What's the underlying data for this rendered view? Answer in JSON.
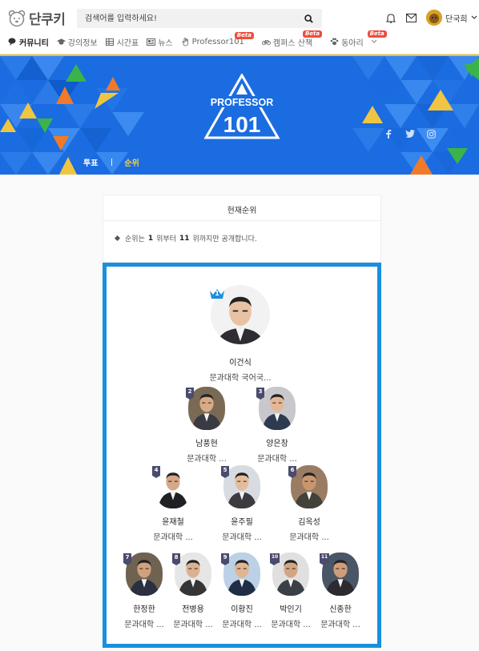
{
  "header": {
    "logo_text": "단쿠키",
    "search_placeholder": "검색어를 입력하세요!",
    "user_name": "단국희",
    "nav": [
      {
        "label": "커뮤니티",
        "icon": "chat-icon",
        "active": true
      },
      {
        "label": "강의정보",
        "icon": "graduation-cap-icon"
      },
      {
        "label": "시간표",
        "icon": "table-icon"
      },
      {
        "label": "뉴스",
        "icon": "newspaper-icon"
      },
      {
        "label": "Professor101",
        "icon": "hand-icon",
        "badge": "Beta"
      },
      {
        "label": "캠퍼스 산책",
        "icon": "bicycle-icon",
        "badge": "Beta"
      },
      {
        "label": "동아리",
        "icon": "paw-icon",
        "badge": "Beta"
      }
    ]
  },
  "banner": {
    "brand_top": "PROFESSOR",
    "brand_number": "101",
    "tabs": [
      {
        "label": "투표"
      },
      {
        "label": "순위",
        "active": true
      }
    ],
    "social": [
      "facebook-icon",
      "twitter-icon",
      "instagram-icon"
    ]
  },
  "panel": {
    "title": "현재순위",
    "note_prefix": "순위는",
    "note_from": "1",
    "note_mid": "위부터",
    "note_to": "11",
    "note_suffix": "위까지만 공개합니다."
  },
  "ranking": [
    {
      "rank": "1",
      "name": "이건식",
      "dept": "문과대학 국어국..."
    },
    {
      "rank": "2",
      "name": "남풍현",
      "dept": "문과대학 ..."
    },
    {
      "rank": "3",
      "name": "양은창",
      "dept": "문과대학 ..."
    },
    {
      "rank": "4",
      "name": "윤재철",
      "dept": "문과대학 ..."
    },
    {
      "rank": "5",
      "name": "윤주필",
      "dept": "문과대학 ..."
    },
    {
      "rank": "6",
      "name": "김옥성",
      "dept": "문과대학 ..."
    },
    {
      "rank": "7",
      "name": "한정한",
      "dept": "문과대학 ..."
    },
    {
      "rank": "8",
      "name": "전병용",
      "dept": "문과대학 ..."
    },
    {
      "rank": "9",
      "name": "이황진",
      "dept": "문과대학 ..."
    },
    {
      "rank": "10",
      "name": "박인기",
      "dept": "문과대학 ..."
    },
    {
      "rank": "11",
      "name": "신종한",
      "dept": "문과대학 ..."
    }
  ],
  "colors": {
    "accent_blue": "#1a8fdf",
    "banner_blue": "#1b6ce0",
    "tab_active": "#f6d33a",
    "beta_red": "#ea4f3f"
  }
}
